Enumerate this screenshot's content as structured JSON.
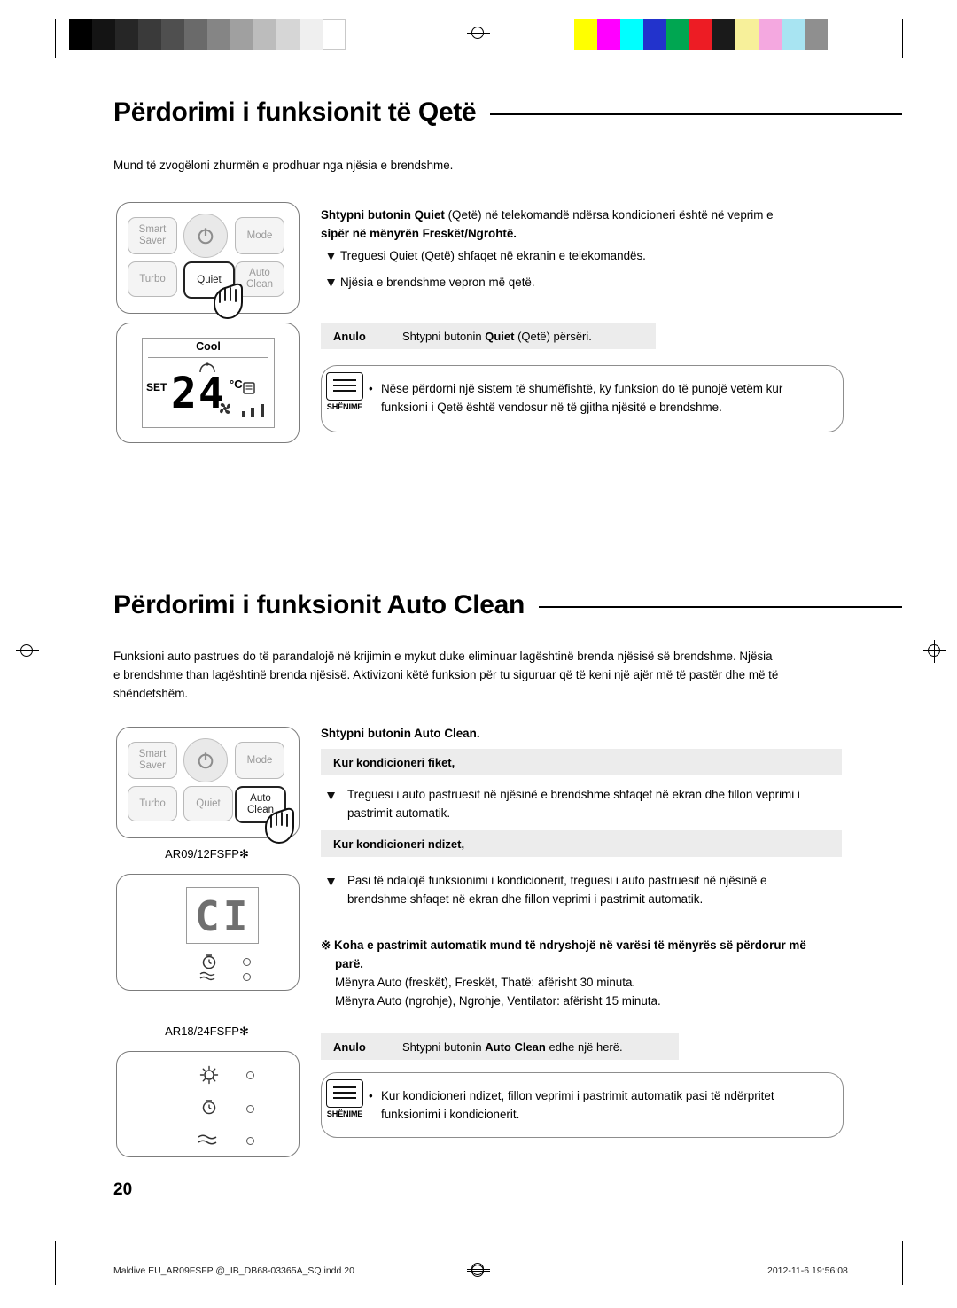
{
  "section1": {
    "title": "Përdorimi i funksionit të Qetë",
    "intro": "Mund të zvogëloni zhurmën e prodhuar nga njësia e brendshme.",
    "instruction_bold_1": "Shtypni butonin ",
    "instruction_kw": "Quiet",
    "instruction_rest": " (Qetë) në telekomandë ndërsa kondicioneri është në veprim e",
    "instruction_line2": "sipër në mënyrën Freskët/Ngrohtë.",
    "bullets": [
      "Treguesi Quiet (Qetë) shfaqet në ekranin e telekomandës.",
      "Njësia e brendshme vepron më qetë."
    ],
    "cancel_label": "Anulo",
    "cancel_text_a": "Shtypni butonin ",
    "cancel_kw": "Quiet",
    "cancel_text_b": " (Qetë) përsëri.",
    "note_tag": "SHËNIME",
    "note_line1": "Nëse përdorni një sistem të shumëfishtë, ky funksion do të punojë vetëm kur",
    "note_line2": "funksioni i Qetë është vendosur në të gjitha njësitë e brendshme."
  },
  "remote1": {
    "buttons": [
      {
        "name": "smart-saver",
        "line1": "Smart",
        "line2": "Saver"
      },
      {
        "name": "power",
        "line1": "",
        "line2": ""
      },
      {
        "name": "mode",
        "line1": "Mode",
        "line2": ""
      },
      {
        "name": "turbo",
        "line1": "Turbo",
        "line2": ""
      },
      {
        "name": "quiet",
        "line1": "Quiet",
        "line2": ""
      },
      {
        "name": "auto-clean",
        "line1": "Auto",
        "line2": "Clean"
      }
    ],
    "highlight": "quiet"
  },
  "display1": {
    "mode_label": "Cool",
    "set_label": "SET",
    "temperature": "24",
    "unit": "°C"
  },
  "section2": {
    "title": "Përdorimi i funksionit Auto Clean",
    "intro_line1": "Funksioni auto pastrues do të parandalojë në krijimin e mykut duke eliminuar lagështinë brenda njësisë së brendshme. Njësia",
    "intro_line2": "e brendshme than lagështinë brenda njësisë. Aktivizoni këtë funksion për tu siguruar që të keni një ajër më të pastër dhe më të",
    "intro_line3": "shëndetshëm.",
    "instruction_a": "Shtypni butonin ",
    "instruction_kw": "Auto Clean",
    "instruction_b": ".",
    "sub1": "Kur kondicioneri fiket,",
    "bullet1_line1": "Treguesi i auto pastruesit në njësinë e brendshme shfaqet në ekran dhe fillon veprimi i",
    "bullet1_line2": "pastrimit automatik.",
    "sub2": "Kur kondicioneri ndizet,",
    "bullet2_line1": "Pasi të ndalojë funksionimi i kondicionerit, treguesi i auto pastruesit në njësinë e",
    "bullet2_line2": "brendshme shfaqet në ekran dhe fillon veprimi i pastrimit automatik.",
    "caution_line1": "Koha e pastrimit automatik mund të ndryshojë në varësi të mënyrës së përdorur më",
    "caution_line2": "parë.",
    "caution_mark": "※",
    "detail_line1": "Mënyra Auto (freskët), Freskët, Thatë: afërisht 30 minuta.",
    "detail_line2": "Mënyra Auto (ngrohje), Ngrohje, Ventilator: afërisht 15 minuta.",
    "cancel_label": "Anulo",
    "cancel_text_a": "Shtypni butonin ",
    "cancel_kw": "Auto Clean",
    "cancel_text_b": " edhe një herë.",
    "note_tag": "SHËNIME",
    "note_line1": "Kur kondicioneri ndizet, fillon veprimi i pastrimit automatik pasi të ndërpritet",
    "note_line2": "funksionimi i kondicionerit."
  },
  "remote2": {
    "buttons": [
      {
        "name": "smart-saver",
        "line1": "Smart",
        "line2": "Saver"
      },
      {
        "name": "power",
        "line1": "",
        "line2": ""
      },
      {
        "name": "mode",
        "line1": "Mode",
        "line2": ""
      },
      {
        "name": "turbo",
        "line1": "Turbo",
        "line2": ""
      },
      {
        "name": "quiet",
        "line1": "Quiet",
        "line2": ""
      },
      {
        "name": "auto-clean",
        "line1": "Auto",
        "line2": "Clean"
      }
    ],
    "highlight": "auto-clean"
  },
  "panel_labels": {
    "model_1": "AR09/12FSFP✻",
    "model_2": "AR18/24FSFP✻"
  },
  "display2": {
    "segment_text": "CI"
  },
  "footer": {
    "page_number": "20",
    "file_name": "Maldive EU_AR09FSFP @_IB_DB68-03365A_SQ.indd   20",
    "timestamp": "2012-11-6   19:56:08"
  },
  "colors": {
    "gray_row": "#ececec",
    "rule": "#000000",
    "outline": "#7c7c7c"
  }
}
